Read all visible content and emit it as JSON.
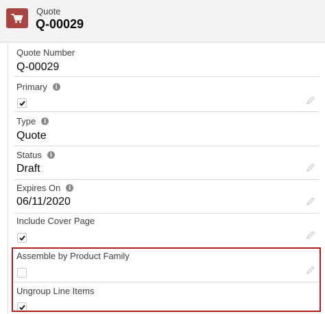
{
  "header": {
    "object_label": "Quote",
    "record_title": "Q-00029",
    "icon": "cart-icon",
    "icon_color": "#a94541"
  },
  "fields": [
    {
      "label": "Quote Number",
      "value": "Q-00029",
      "info": false,
      "editable": false
    },
    {
      "label": "Primary",
      "checked": true,
      "info": true,
      "editable": true
    },
    {
      "label": "Type",
      "value": "Quote",
      "info": true,
      "editable": false
    },
    {
      "label": "Status",
      "value": "Draft",
      "info": true,
      "editable": true
    },
    {
      "label": "Expires On",
      "value": "06/11/2020",
      "info": true,
      "editable": true
    },
    {
      "label": "Include Cover Page",
      "checked": true,
      "info": false,
      "editable": true
    },
    {
      "label": "Assemble by Product Family",
      "checked": false,
      "info": false,
      "editable": true
    },
    {
      "label": "Ungroup Line Items",
      "checked": true,
      "info": false,
      "editable": false
    }
  ],
  "highlight_color": "#b11c1c"
}
